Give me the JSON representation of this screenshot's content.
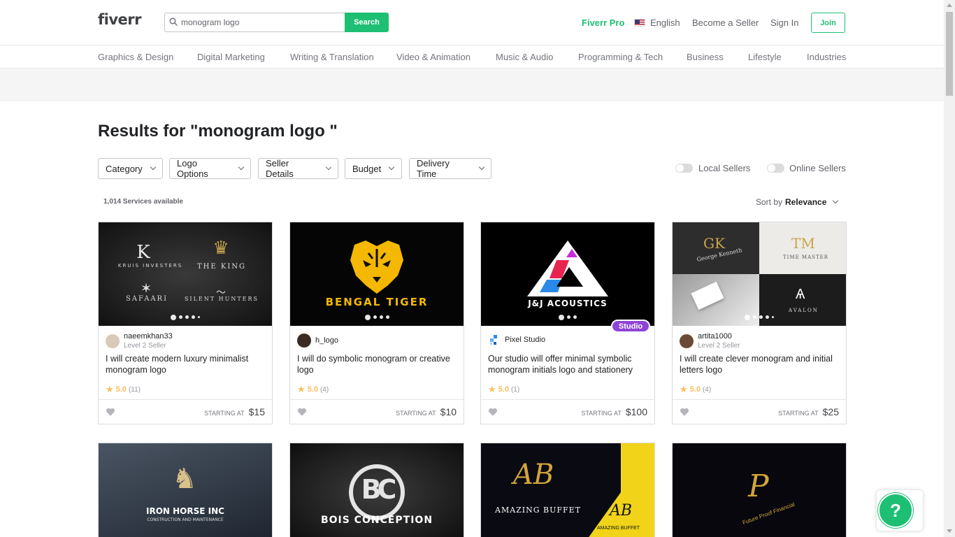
{
  "header": {
    "logo": "fiverr",
    "search_value": "monogram logo",
    "search_button": "Search",
    "pro": "Fiverr Pro",
    "language": "English",
    "become_seller": "Become a Seller",
    "sign_in": "Sign In",
    "join": "Join"
  },
  "categories": [
    "Graphics & Design",
    "Digital Marketing",
    "Writing & Translation",
    "Video & Animation",
    "Music & Audio",
    "Programming & Tech",
    "Business",
    "Lifestyle",
    "Industries"
  ],
  "results_title": "Results for \"monogram logo \"",
  "filters": [
    "Category",
    "Logo Options",
    "Seller Details",
    "Budget",
    "Delivery Time"
  ],
  "toggles": [
    "Local Sellers",
    "Online Sellers"
  ],
  "services_count": "1,014 Services available",
  "sort": {
    "label": "Sort by",
    "value": "Relevance"
  },
  "gigs": [
    {
      "seller": "naeemkhan33",
      "level": "Level 2 Seller",
      "title": "I will create modern luxury minimalist monogram logo",
      "score": "5.0",
      "reviews": "(11)",
      "starting": "STARTING AT",
      "price": "$15"
    },
    {
      "seller": "h_logo",
      "level": "",
      "title": "I will do symbolic monogram or creative logo",
      "score": "5.0",
      "reviews": "(4)",
      "starting": "STARTING AT",
      "price": "$10"
    },
    {
      "seller": "Pixel Studio",
      "level": "",
      "title": "Our studio will offer minimal symbolic monogram initials logo and stationery",
      "score": "5.0",
      "reviews": "(1)",
      "starting": "STARTING AT",
      "price": "$100",
      "badge": "Studio"
    },
    {
      "seller": "artita1000",
      "level": "Level 2 Seller",
      "title": "I will create clever monogram and initial letters logo",
      "score": "5.0",
      "reviews": "(4)",
      "starting": "STARTING AT",
      "price": "$25"
    }
  ],
  "image_text": {
    "g1": {
      "a": "KRUIS INVESTERS",
      "b": "THE KING",
      "c": "SAFAARI",
      "d": "SILENT HUNTERS"
    },
    "g2": "BENGAL TIGER",
    "g3": "J&J ACOUSTICS",
    "g4": {
      "a": "George Kenneth",
      "b": "TIME MASTER",
      "c": "AVALON"
    },
    "r2a": "IRON HORSE INC",
    "r2a_sub": "CONSTRUCTION AND MAINTENANCE",
    "r2b": "BOIS CONCEPTION",
    "r2c": "AMAZING BUFFET",
    "r2c_small": "AMAZING BUFFET",
    "r2d": "Future Proof Financial"
  },
  "help": "?",
  "colors": {
    "brand": "#1dbf73",
    "studio": "#8e44d6",
    "star": "#ffbe5b"
  }
}
